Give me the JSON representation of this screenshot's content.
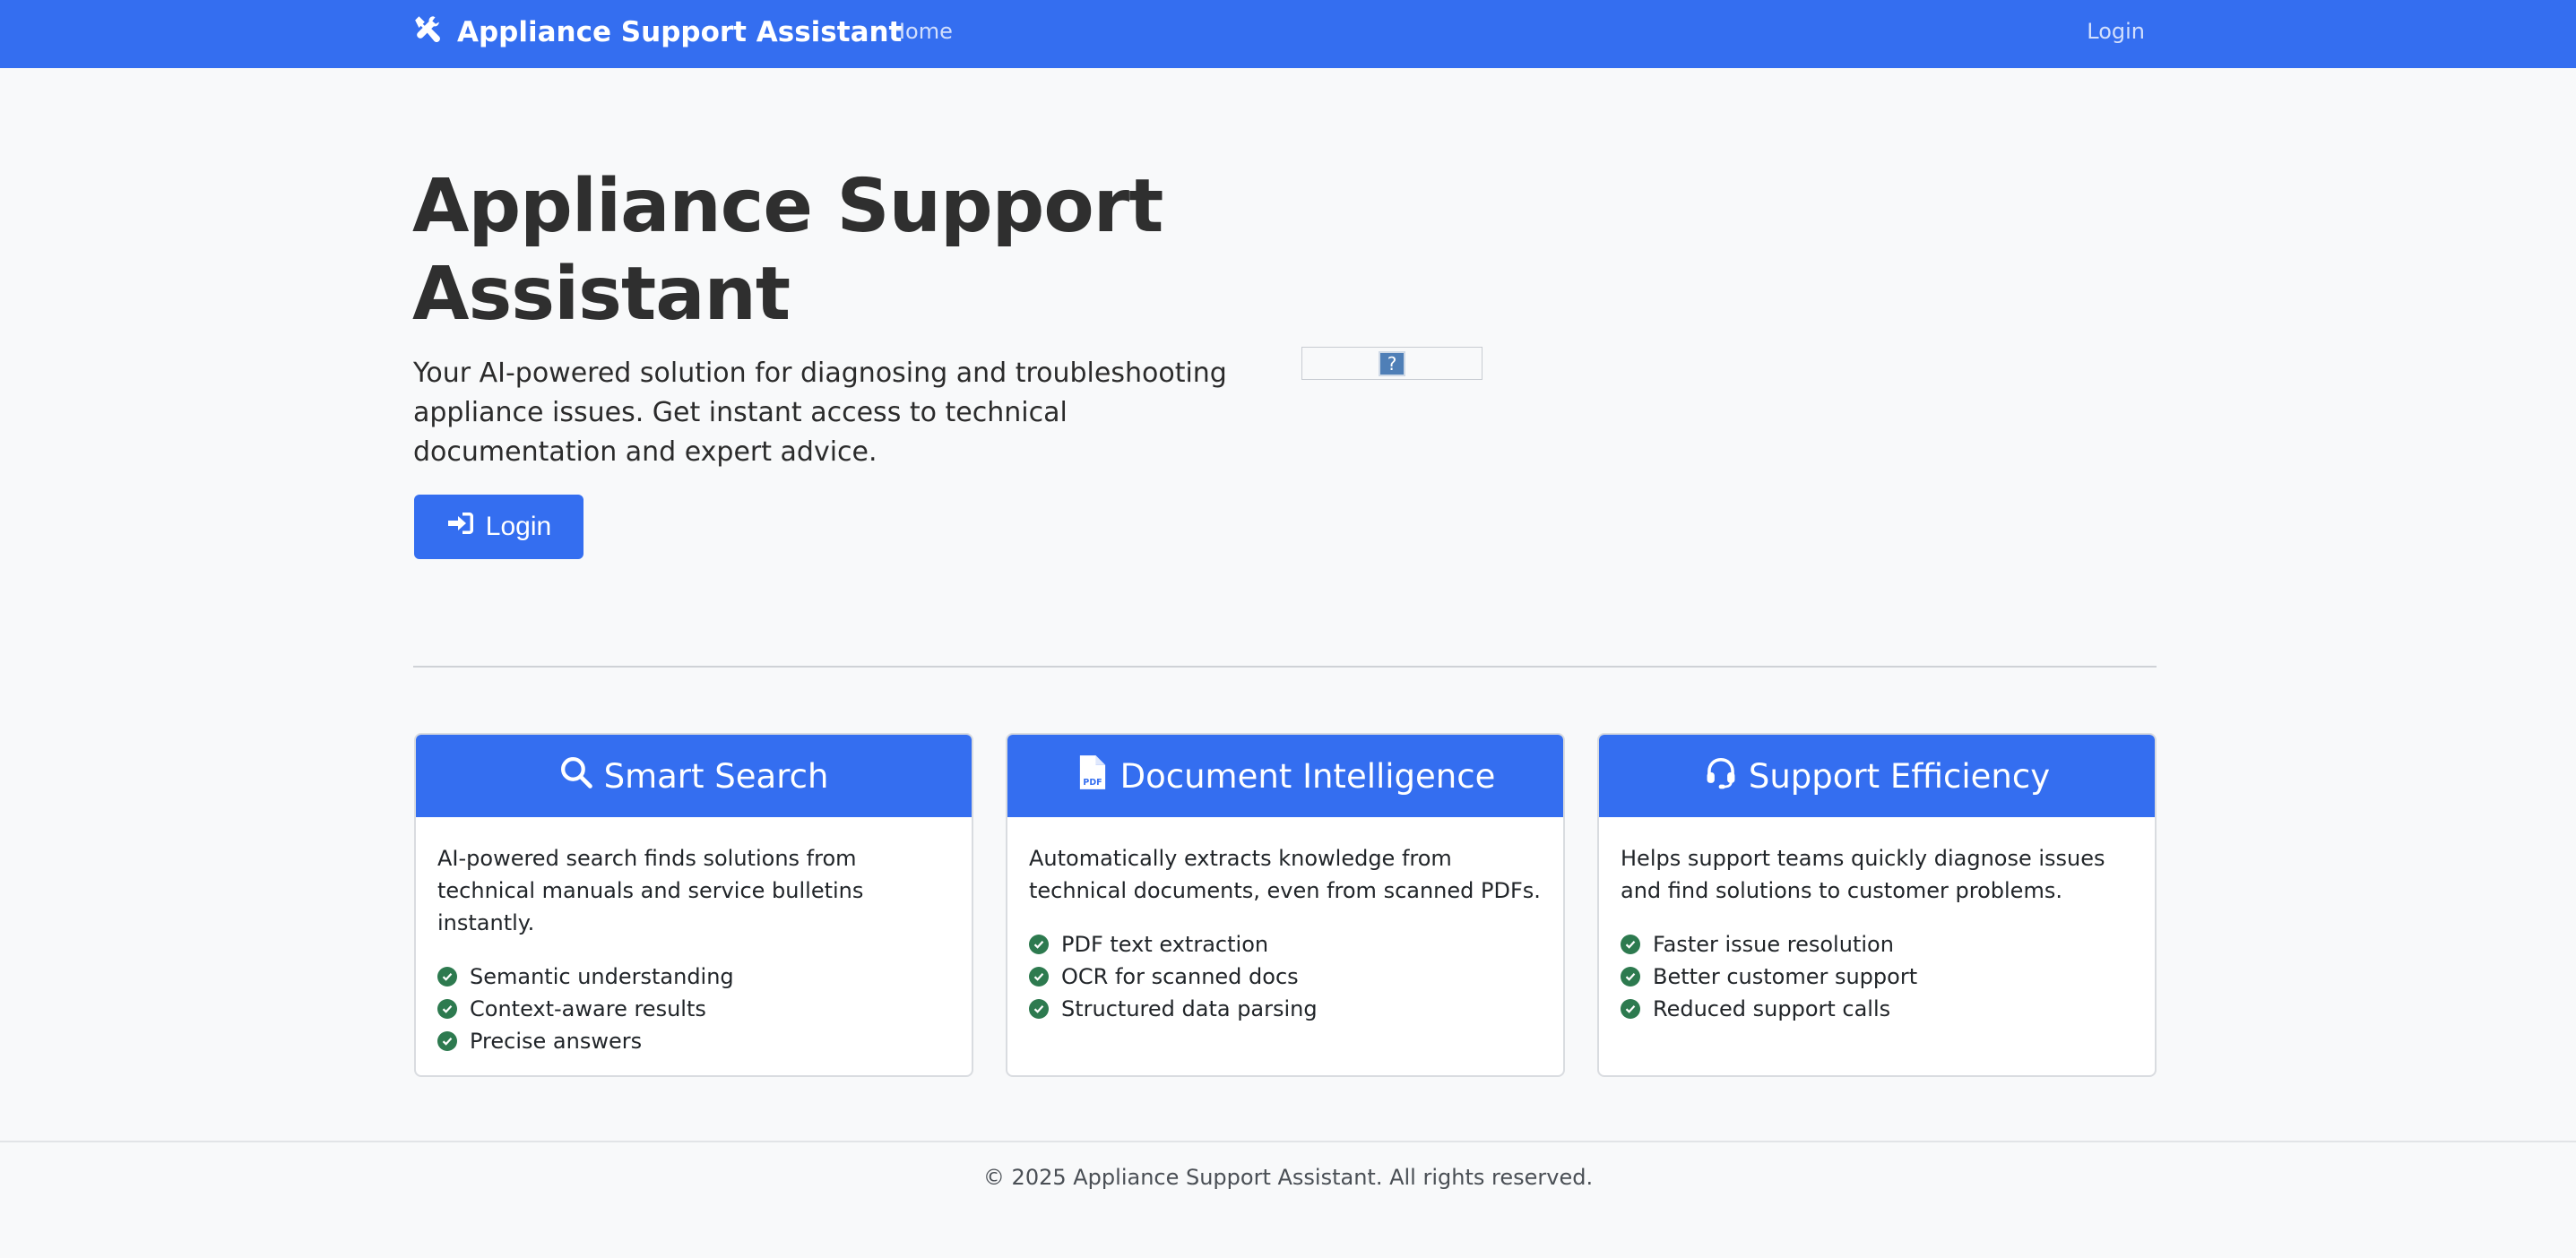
{
  "navbar": {
    "brand_icon": "tools-icon",
    "brand": "Appliance Support Assistant",
    "home": "Home",
    "login": "Login",
    "color": "#346ef0"
  },
  "hero": {
    "title": "Appliance Support Assistant",
    "lead": "Your AI-powered solution for diagnosing and troubleshooting appliance issues. Get instant access to technical documentation and expert advice.",
    "button_label": "Login",
    "button_icon": "sign-in-icon",
    "image_placeholder": "?"
  },
  "cards": [
    {
      "icon": "search-icon",
      "title": "Smart Search",
      "description": "AI-powered search finds solutions from technical manuals and service bulletins instantly.",
      "items": [
        "Semantic understanding",
        "Context-aware results",
        "Precise answers"
      ]
    },
    {
      "icon": "file-pdf-icon",
      "title": "Document Intelligence",
      "description": "Automatically extracts knowledge from technical documents, even from scanned PDFs.",
      "items": [
        "PDF text extraction",
        "OCR for scanned docs",
        "Structured data parsing"
      ]
    },
    {
      "icon": "headset-icon",
      "title": "Support Efficiency",
      "description": "Helps support teams quickly diagnose issues and find solutions to customer problems.",
      "items": [
        "Faster issue resolution",
        "Better customer support",
        "Reduced support calls"
      ]
    }
  ],
  "footer": {
    "text": "© 2025 Appliance Support Assistant. All rights reserved."
  }
}
